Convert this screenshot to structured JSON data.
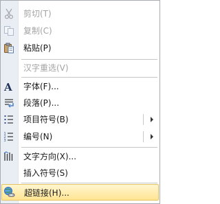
{
  "menu": {
    "items": [
      {
        "label": "剪切(T)",
        "icon": "scissors-icon",
        "disabled": true
      },
      {
        "label": "复制(C)",
        "icon": "copy-icon",
        "disabled": true
      },
      {
        "label": "粘贴(P)",
        "icon": "paste-icon",
        "disabled": false
      },
      {
        "label": "汉字重选(V)",
        "icon": "",
        "disabled": true
      },
      {
        "label": "字体(F)...",
        "icon": "font-icon",
        "disabled": false
      },
      {
        "label": "段落(P)...",
        "icon": "paragraph-icon",
        "disabled": false
      },
      {
        "label": "项目符号(B)",
        "icon": "bullets-icon",
        "disabled": false,
        "submenu": true
      },
      {
        "label": "编号(N)",
        "icon": "numbering-icon",
        "disabled": false,
        "submenu": true
      },
      {
        "label": "文字方向(X)...",
        "icon": "text-direction-icon",
        "disabled": false
      },
      {
        "label": "插入符号(S)",
        "icon": "",
        "disabled": false
      },
      {
        "label": "超链接(H)...",
        "icon": "hyperlink-icon",
        "disabled": false,
        "highlighted": true
      }
    ]
  },
  "colors": {
    "highlight_top": "#fff6d0",
    "highlight_bottom": "#ffe492",
    "disabled_text": "#a3a3a3",
    "gutter": "#e9eef5"
  }
}
